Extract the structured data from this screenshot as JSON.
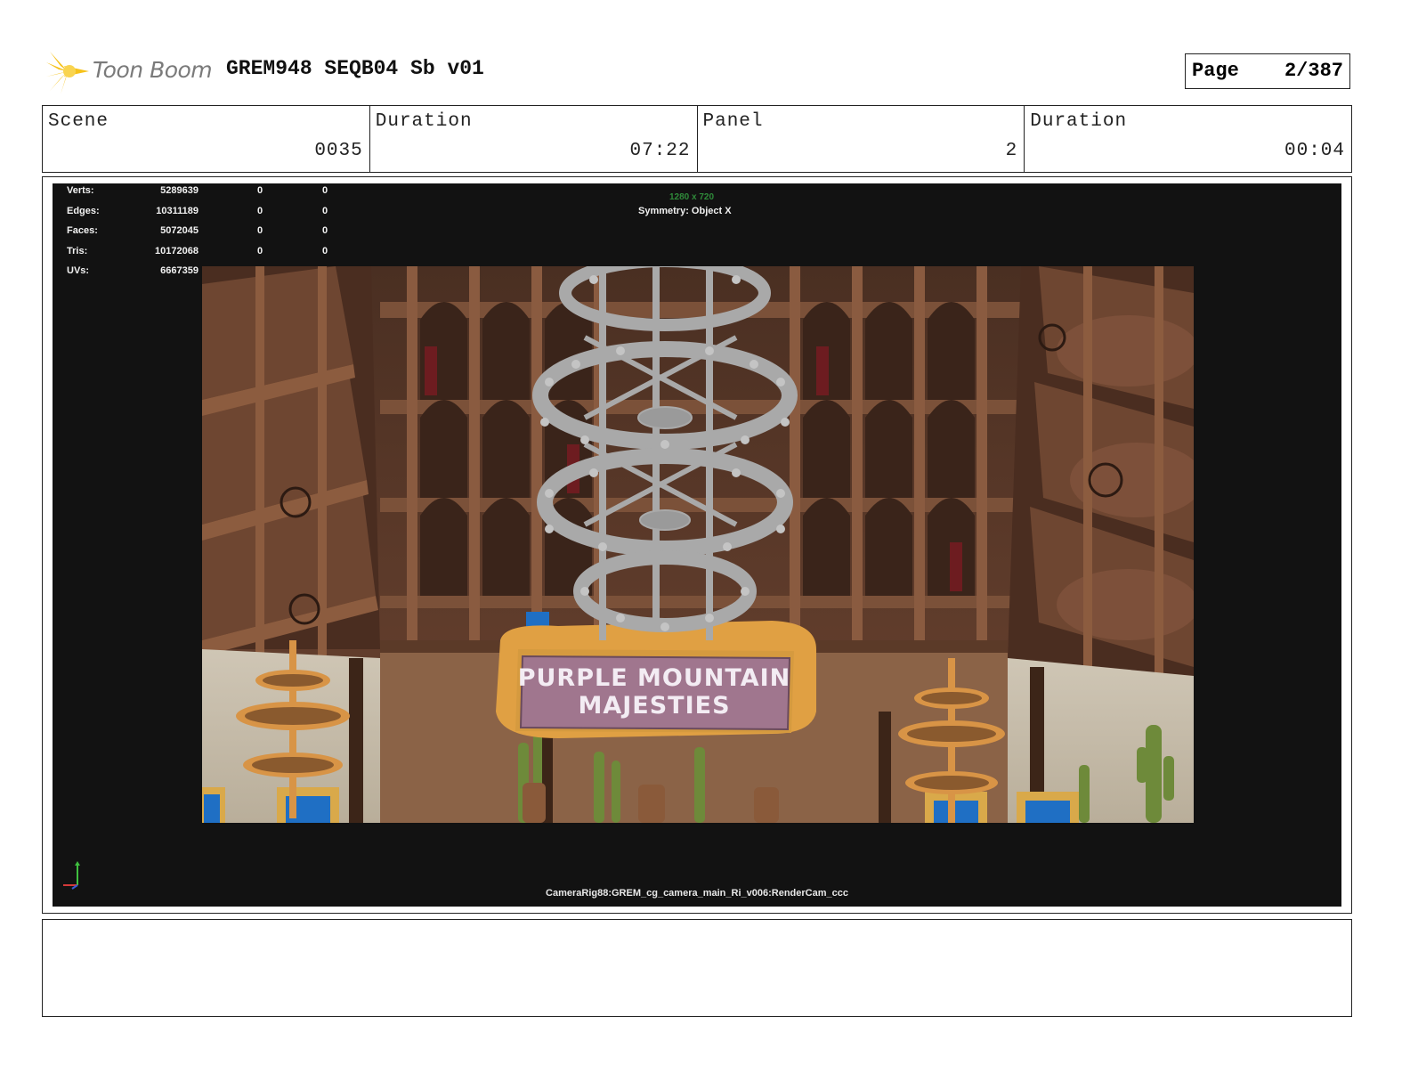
{
  "header": {
    "logo_text": "Toon Boom",
    "project_title": "GREM948 SEQB04 Sb v01",
    "page_label": "Page",
    "page_number": "2/387"
  },
  "info": {
    "scene_label": "Scene",
    "scene_value": "0035",
    "scene_duration_label": "Duration",
    "scene_duration_value": "07:22",
    "panel_label": "Panel",
    "panel_value": "2",
    "panel_duration_label": "Duration",
    "panel_duration_value": "00:04"
  },
  "viewport": {
    "stats": [
      {
        "label": "Verts:",
        "v1": "5289639",
        "v2": "0",
        "v3": "0"
      },
      {
        "label": "Edges:",
        "v1": "10311189",
        "v2": "0",
        "v3": "0"
      },
      {
        "label": "Faces:",
        "v1": "5072045",
        "v2": "0",
        "v3": "0"
      },
      {
        "label": "Tris:",
        "v1": "10172068",
        "v2": "0",
        "v3": "0"
      },
      {
        "label": "UVs:",
        "v1": "6667359",
        "v2": "0",
        "v3": "0"
      }
    ],
    "resolution": "1280 x 720",
    "symmetry": "Symmetry: Object X",
    "camera": "CameraRig88:GREM_cg_camera_main_Ri_v006:RenderCam_ccc",
    "sign_line1": "PURPLE MOUNTAIN",
    "sign_line2": "MAJESTIES"
  },
  "colors": {
    "logo_yellow": "#f6c21a",
    "viewport_bg": "#121212",
    "wood_dark": "#5a3a28",
    "wood_mid": "#7a4f35",
    "chandelier_gray": "#a9a9a9",
    "sign_purple": "#a0768e",
    "sign_frame": "#e0a043",
    "cactus_green": "#6e8a3a"
  }
}
